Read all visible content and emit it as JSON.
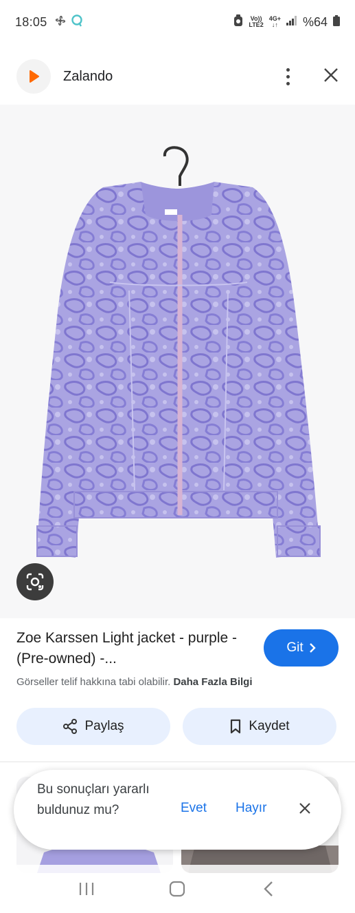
{
  "status_bar": {
    "time": "18:05",
    "volte": "Vo))",
    "lte": "LTE2",
    "net": "4G+",
    "battery": "%64"
  },
  "header": {
    "site_name": "Zalando",
    "logo_color": "#ff6900"
  },
  "result": {
    "title": "Zoe Karssen Light jacket - purple - (Pre-owned) -...",
    "go_label": "Git",
    "copyright_text": "Görseller telif hakkına tabi olabilir.",
    "more_info": "Daha Fazla Bilgi"
  },
  "actions": {
    "share_label": "Paylaş",
    "save_label": "Kaydet"
  },
  "feedback": {
    "question": "Bu sonuçları yararlı buldunuz mu?",
    "yes": "Evet",
    "no": "Hayır"
  },
  "colors": {
    "accent": "#1a73e8",
    "chip_bg": "#e8f0fe",
    "jacket": "#a9a3e0"
  }
}
